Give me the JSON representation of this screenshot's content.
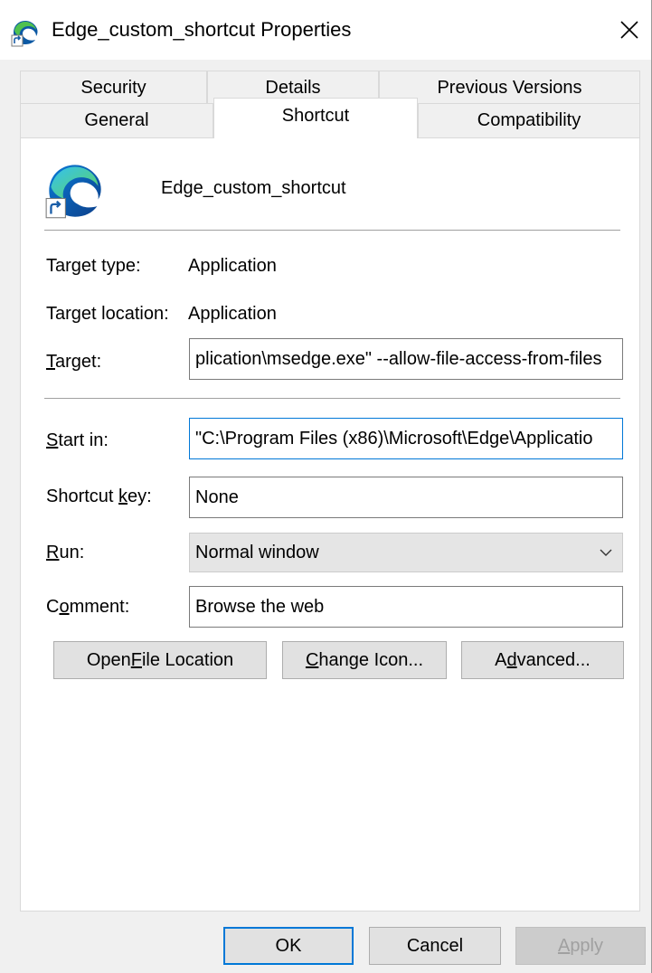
{
  "window": {
    "title": "Edge_custom_shortcut Properties",
    "close_glyph": "✕"
  },
  "tabs": {
    "row1": [
      "Security",
      "Details",
      "Previous Versions"
    ],
    "row2": [
      "General",
      "Shortcut",
      "Compatibility"
    ],
    "active": "Shortcut"
  },
  "shortcut": {
    "name": "Edge_custom_shortcut",
    "target_type_label": "Target type:",
    "target_type_value": "Application",
    "target_location_label": "Target location:",
    "target_location_value": "Application",
    "target_label_pre": "",
    "target_label_mnemonic": "T",
    "target_label_post": "arget:",
    "target_value": "plication\\msedge.exe\" --allow-file-access-from-files",
    "start_in_label_pre": "",
    "start_in_label_mnemonic": "S",
    "start_in_label_post": "tart in:",
    "start_in_value": "\"C:\\Program Files (x86)\\Microsoft\\Edge\\Applicatio",
    "shortcut_key_label_pre": "Shortcut ",
    "shortcut_key_label_mnemonic": "k",
    "shortcut_key_label_post": "ey:",
    "shortcut_key_value": "None",
    "run_label_pre": "",
    "run_label_mnemonic": "R",
    "run_label_post": "un:",
    "run_value": "Normal window",
    "comment_label_pre": "C",
    "comment_label_mnemonic": "o",
    "comment_label_post": "mment:",
    "comment_value": "Browse the web"
  },
  "buttons": {
    "open_file_location_pre": "Open ",
    "open_file_location_mnemonic": "F",
    "open_file_location_post": "ile Location",
    "change_icon_pre": "",
    "change_icon_mnemonic": "C",
    "change_icon_post": "hange Icon...",
    "advanced_pre": "A",
    "advanced_mnemonic": "d",
    "advanced_post": "vanced...",
    "ok": "OK",
    "cancel": "Cancel",
    "apply_pre": "",
    "apply_mnemonic": "A",
    "apply_post": "pply"
  },
  "colors": {
    "accent": "#0078d7",
    "edge_blue": "#0c59a4",
    "edge_green": "#4fc14f"
  }
}
